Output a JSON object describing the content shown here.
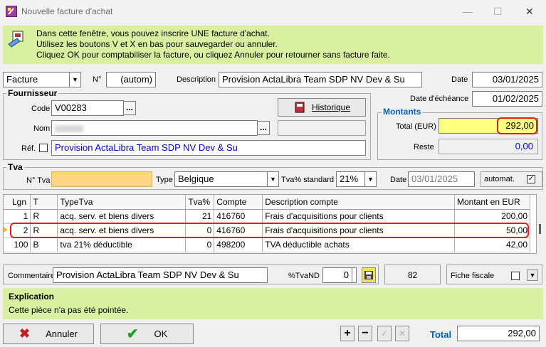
{
  "window": {
    "title": "Nouvelle facture d'achat"
  },
  "info": {
    "line1": "Dans cette fenêtre, vous pouvez inscrire UNE facture d'achat.",
    "line2": "Utilisez les boutons V et X en bas pour sauvegarder ou annuler.",
    "line3": "Cliquez OK pour comptabiliser la facture, ou cliquez Annuler pour retourner sans facture faite."
  },
  "header": {
    "doc_type": "Facture",
    "number_label": "N°",
    "number_value": "(autom)",
    "description_label": "Description",
    "description_value": "Provision ActaLibra Team SDP NV Dev & Su",
    "date_label": "Date",
    "date_value": "03/01/2025",
    "due_label": "Date d'échéance",
    "due_value": "01/02/2025"
  },
  "supplier": {
    "title": "Fournisseur",
    "code_label": "Code",
    "code_value": "V00283",
    "name_label": "Nom",
    "ref_label": "Réf.",
    "ref_value": "Provision ActaLibra Team SDP NV Dev & Su",
    "history_label": "Historique"
  },
  "amounts": {
    "title": "Montants",
    "total_label": "Total (EUR)",
    "total_value": "292,00",
    "rest_label": "Reste",
    "rest_value": "0,00"
  },
  "tva": {
    "title": "Tva",
    "number_label": "N° Tva",
    "type_label": "Type",
    "type_value": "Belgique",
    "std_label": "Tva% standard",
    "std_value": "21%",
    "date_label": "Date",
    "date_value": "03/01/2025",
    "auto_label": "automat."
  },
  "grid": {
    "columns": [
      "Lgn",
      "T",
      "TypeTva",
      "Tva%",
      "Compte",
      "Description compte",
      "Montant en EUR"
    ],
    "rows": [
      [
        "1",
        "R",
        "acq. serv. et biens divers",
        "21",
        "416760",
        "Frais d'acquisitions pour clients",
        "200,00"
      ],
      [
        "2",
        "R",
        "acq. serv. et biens divers",
        "0",
        "416760",
        "Frais d'acquisitions pour clients",
        "50,00"
      ],
      [
        "100",
        "B",
        "tva 21% déductible",
        "0",
        "498200",
        "TVA déductible achats",
        "42,00"
      ]
    ]
  },
  "footer": {
    "comment_label": "Commentaire",
    "comment_value": "Provision ActaLibra Team SDP NV Dev & Su",
    "tvand_label": "%TvaND",
    "tvand_value": "0",
    "count_value": "82",
    "fiche_label": "Fiche fiscale"
  },
  "explanation": {
    "title": "Explication",
    "text": "Cette pièce n'a pas été pointée."
  },
  "actions": {
    "cancel_label": "Annuler",
    "ok_label": "OK",
    "total_label": "Total",
    "total_value": "292,00"
  },
  "colors": {
    "accent_blue": "#0060c0",
    "info_green": "#d8f0a0",
    "highlight_yellow": "#ffff80",
    "ring_red": "#e02020",
    "tva_orange": "#ffd580"
  }
}
